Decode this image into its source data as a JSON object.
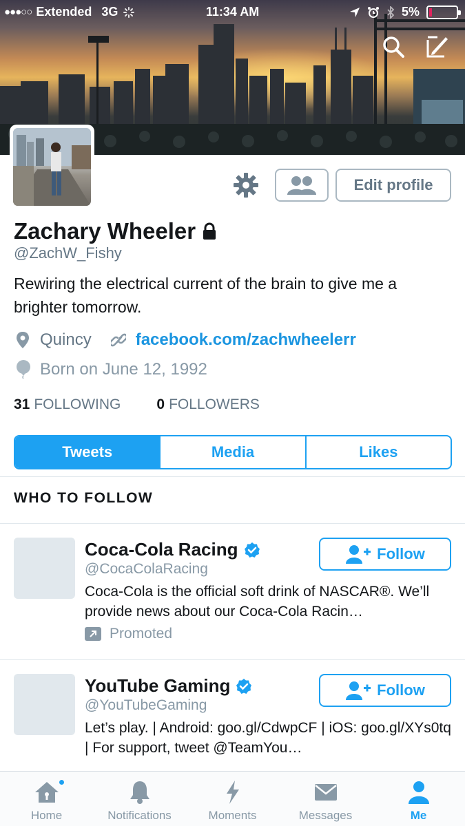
{
  "status_bar": {
    "signal_dots": "●●●○○",
    "carrier": "Extended",
    "network": "3G",
    "time": "11:34 AM",
    "battery": "5%"
  },
  "banner": {
    "icons": [
      "search-icon",
      "compose-icon"
    ]
  },
  "profile": {
    "name": "Zachary Wheeler",
    "handle": "@ZachW_Fishy",
    "bio": "Rewiring the electrical current of the brain to give me a brighter tomorrow.",
    "location": "Quincy",
    "website": "facebook.com/zachwheelerr",
    "birthday": "Born on June 12, 1992",
    "following_count": "31",
    "following_label": "FOLLOWING",
    "followers_count": "0",
    "followers_label": "FOLLOWERS",
    "edit_profile_label": "Edit profile"
  },
  "tabs": [
    "Tweets",
    "Media",
    "Likes"
  ],
  "who_to_follow": {
    "heading": "WHO TO FOLLOW",
    "suggestions": [
      {
        "name": "Coca-Cola Racing",
        "handle": "@CocaColaRacing",
        "description": "Coca-Cola is the official soft drink of NASCAR®. We’ll provide news about our Coca-Cola Racin…",
        "follow_label": "Follow",
        "promoted_label": "Promoted"
      },
      {
        "name": "YouTube Gaming",
        "handle": "@YouTubeGaming",
        "description": "Let’s play. | Android: goo.gl/CdwpCF | iOS: goo.gl/XYs0tq | For support, tweet @TeamYou…",
        "follow_label": "Follow"
      }
    ]
  },
  "bottom_nav": {
    "home": "Home",
    "notifications": "Notifications",
    "moments": "Moments",
    "messages": "Messages",
    "me": "Me"
  },
  "colors": {
    "accent": "#1da1f2",
    "secondary_text": "#657786"
  }
}
